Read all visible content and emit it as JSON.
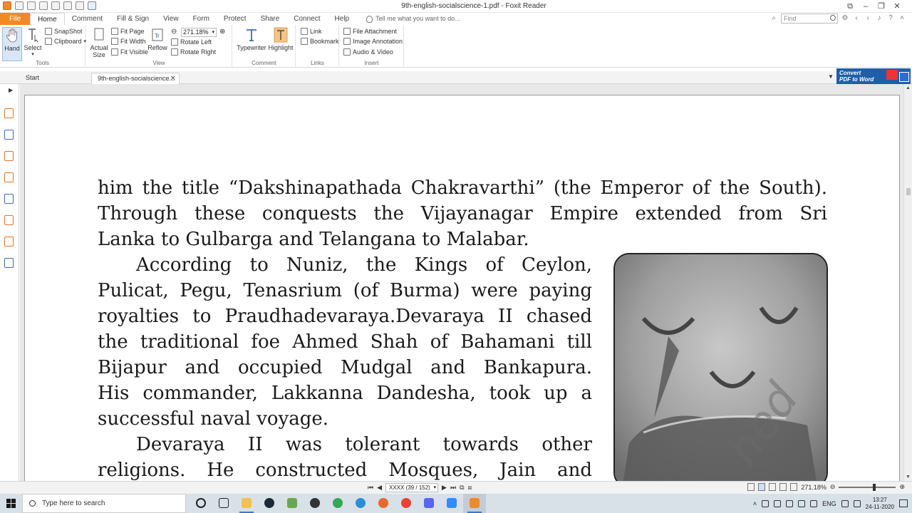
{
  "window": {
    "title": "9th-english-socialscience-1.pdf - Foxit Reader"
  },
  "menu": {
    "file": "File",
    "tabs": [
      "Home",
      "Comment",
      "Fill & Sign",
      "View",
      "Form",
      "Protect",
      "Share",
      "Connect",
      "Help"
    ],
    "tell_me": "Tell me what you want to do...",
    "find_placeholder": "Find"
  },
  "ribbon": {
    "tools": {
      "label": "Tools",
      "hand": "Hand",
      "select": "Select",
      "snapshot": "SnapShot",
      "clipboard": "Clipboard"
    },
    "view": {
      "label": "View",
      "actual_size_1": "Actual",
      "actual_size_2": "Size",
      "fit_page": "Fit Page",
      "fit_width": "Fit Width",
      "fit_visible": "Fit Visible",
      "reflow": "Reflow",
      "zoom": "271.18%",
      "rotate_left": "Rotate Left",
      "rotate_right": "Rotate Right"
    },
    "comment": {
      "label": "Comment",
      "typewriter": "Typewriter",
      "highlight": "Highlight"
    },
    "links": {
      "label": "Links",
      "link": "Link",
      "bookmark": "Bookmark"
    },
    "insert": {
      "label": "Insert",
      "file_attachment": "File Attachment",
      "image_annotation": "Image Annotation",
      "audio_video": "Audio & Video"
    }
  },
  "doc_tabs": {
    "start": "Start",
    "doc": "9th-english-socialscience...",
    "convert_1": "Convert",
    "convert_2": "PDF to Word"
  },
  "page": {
    "lines": [
      "him the title “Dakshinapathada Chakravarthi” (the Emperor of the South).",
      "Through these conquests the Vijayanagar Empire extended from Sri",
      "Lanka to Gulbarga and Telangana to Malabar.",
      "According to Nuniz, the Kings of Ceylon,",
      "Pulicat, Pegu, Tenasrium (of Burma) were paying",
      "royalties to Praudhadevaraya.Devaraya II chased",
      "the traditional foe Ahmed Shah of Bahamani till",
      "Bijapur and occupied Mudgal and Bankapura.",
      "His commander, Lakkanna Dandesha, took up a",
      "successful naval voyage.",
      "Devaraya II was tolerant towards other",
      "religions. He constructed Mosques, Jain and"
    ],
    "figure_watermark": "hed"
  },
  "status": {
    "page_box": "XXXX (39 / 152)",
    "zoom": "271.18%"
  },
  "taskbar": {
    "search": "Type here to search",
    "lang": "ENG",
    "time": "13:27",
    "date": "24-11-2020"
  },
  "colors": {
    "accent": "#f08a24",
    "ribbon_select": "#d8e6f6",
    "convert_bg": "#1f5fa8",
    "taskbar": "#d8e0e8"
  }
}
